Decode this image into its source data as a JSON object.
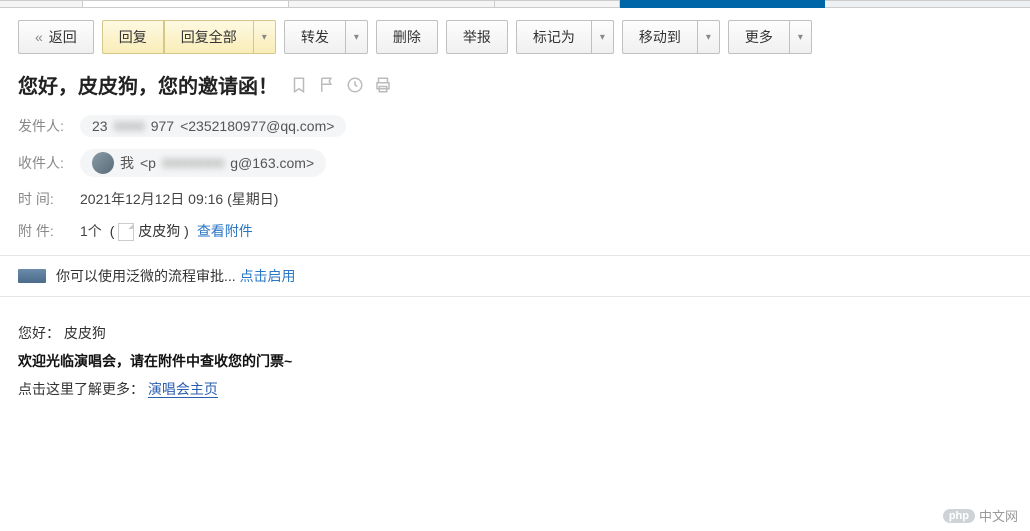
{
  "toolbar": {
    "back": "返回",
    "reply": "回复",
    "reply_all": "回复全部",
    "forward": "转发",
    "delete": "删除",
    "report": "举报",
    "mark_as": "标记为",
    "move_to": "移动到",
    "more": "更多"
  },
  "subject": "您好，皮皮狗，您的邀请函！",
  "meta": {
    "sender_label": "发件人:",
    "sender_name_prefix": "23",
    "sender_name_suffix": "977",
    "sender_email": "<2352180977@qq.com>",
    "recipient_label": "收件人:",
    "recipient_name": "我",
    "recipient_email_prefix": "<p",
    "recipient_email_suffix": "g@163.com>",
    "date_label": "时   间:",
    "date_value": "2021年12月12日 09:16 (星期日)",
    "attach_label": "附   件:",
    "attach_count": "1个",
    "attach_name": "皮皮狗",
    "attach_view": "查看附件"
  },
  "notice": {
    "text": "你可以使用泛微的流程审批... ",
    "action": "点击启用"
  },
  "body": {
    "greeting_label": "您好：",
    "greeting_name": "皮皮狗",
    "welcome": "欢迎光临演唱会，请在附件中查收您的门票~",
    "learn_more": "点击这里了解更多：",
    "link_text": "演唱会主页"
  },
  "watermark": {
    "badge": "php",
    "text": "中文网"
  }
}
